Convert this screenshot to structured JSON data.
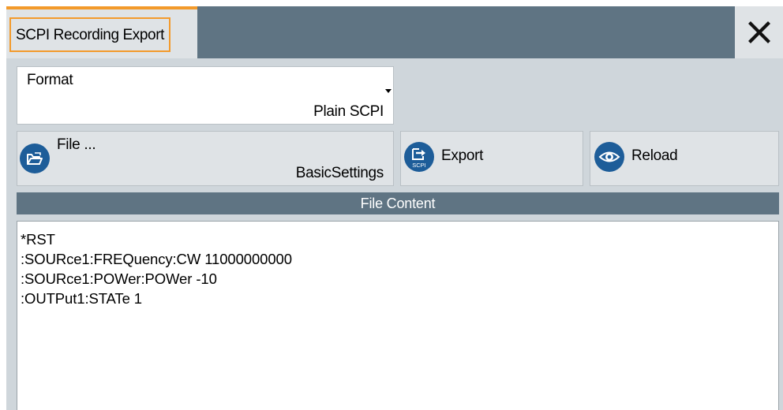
{
  "dialog": {
    "title": "SCPI Recording Export",
    "close_icon": "close-icon"
  },
  "format": {
    "label": "Format",
    "value": "Plain SCPI"
  },
  "file": {
    "label": "File ...",
    "value": "BasicSettings",
    "icon": "folder-open-icon"
  },
  "export": {
    "label": "Export",
    "icon": "export-scpi-icon",
    "icon_text": "SCPI"
  },
  "reload": {
    "label": "Reload",
    "icon": "eye-icon"
  },
  "file_content": {
    "header": "File Content",
    "lines": [
      "*RST",
      ":SOURce1:FREQuency:CW 11000000000",
      ":SOURce1:POWer:POWer -10",
      ":OUTPut1:STATe 1"
    ]
  },
  "colors": {
    "accent": "#f39a2b",
    "header_bar": "#5f7483",
    "icon_blue": "#1d5d99",
    "button_bg": "#dfe3e6",
    "panel_bg": "#cfd6db"
  }
}
